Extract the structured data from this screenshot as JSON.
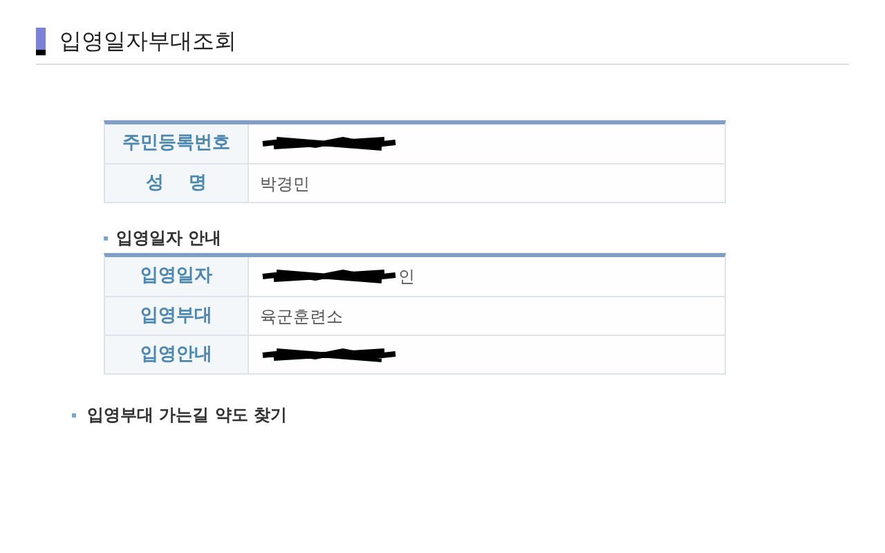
{
  "page_title": "입영일자부대조회",
  "personal_table": [
    {
      "label": "주민등록번호",
      "redacted": true
    },
    {
      "label": "성　 명",
      "value": "박경민",
      "redacted": false
    }
  ],
  "enlistment_section": {
    "heading": "입영일자 안내",
    "rows": [
      {
        "label": "입영일자",
        "value": "인",
        "redacted": true
      },
      {
        "label": "입영부대",
        "value": "육군훈련소",
        "redacted": false
      },
      {
        "label": "입영안내",
        "redacted": true
      }
    ]
  },
  "map_link": "입영부대 가는길 약도 찾기"
}
